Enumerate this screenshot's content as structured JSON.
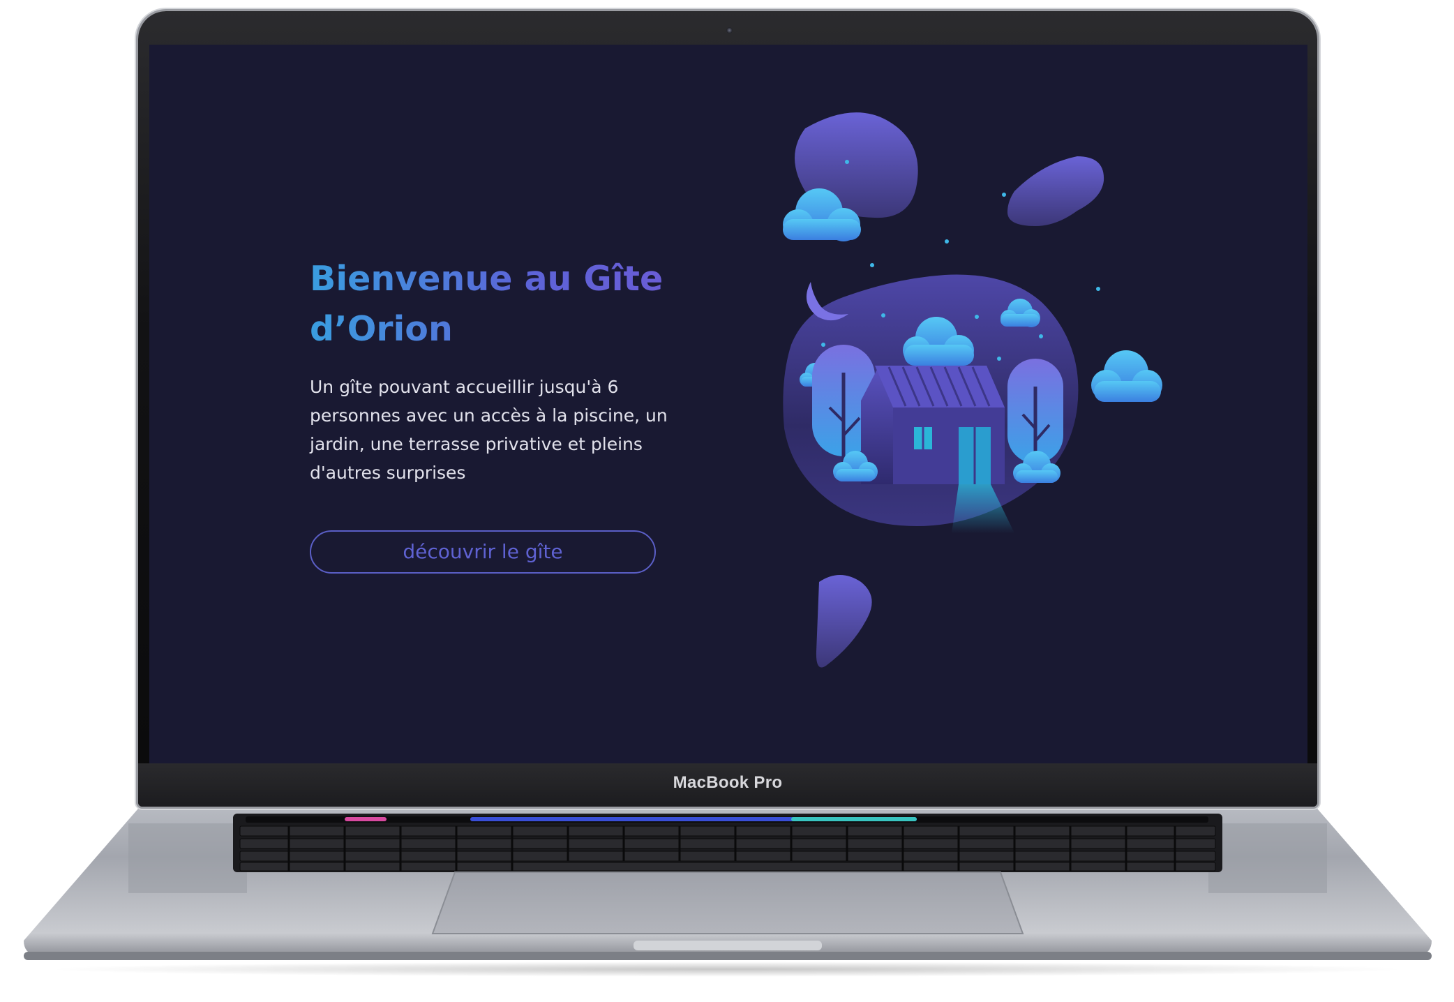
{
  "device": {
    "brand_label": "MacBook Pro"
  },
  "page": {
    "hero": {
      "title": "Bienvenue au Gîte d’Orion",
      "description": "Un gîte pouvant accueillir jusqu'à 6 personnes avec un accès à la piscine, un jardin, une terrasse privative et pleins d'autres surprises",
      "cta_label": "découvrir le gîte"
    },
    "illustration": {
      "subject": "night-house-illustration"
    }
  },
  "colors": {
    "screen_background": "#191932",
    "title_gradient_start": "#3a9ee0",
    "title_gradient_end": "#6d5bd6",
    "cta_border": "#5b5fc7",
    "body_text": "#e2e2ec"
  }
}
